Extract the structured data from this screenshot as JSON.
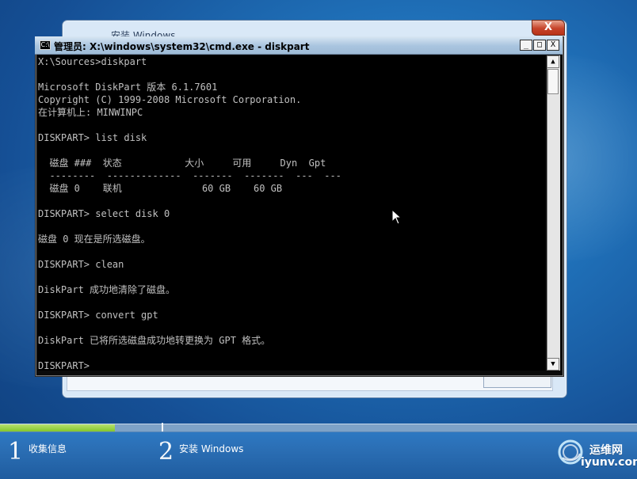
{
  "setup_window": {
    "title": "安装 Windows",
    "close_glyph": "X"
  },
  "cmd_window": {
    "title": "管理员: X:\\windows\\system32\\cmd.exe - diskpart",
    "icon_text": "C:\\",
    "controls": {
      "minimize": "_",
      "maximize": "□",
      "close": "X"
    },
    "scrollbar": {
      "up": "▲",
      "down": "▼"
    },
    "lines": [
      "X:\\Sources>diskpart",
      "",
      "Microsoft DiskPart 版本 6.1.7601",
      "Copyright (C) 1999-2008 Microsoft Corporation.",
      "在计算机上: MINWINPC",
      "",
      "DISKPART> list disk",
      "",
      "  磁盘 ###  状态           大小     可用     Dyn  Gpt",
      "  --------  -------------  -------  -------  ---  ---",
      "  磁盘 0    联机              60 GB    60 GB",
      "",
      "DISKPART> select disk 0",
      "",
      "磁盘 0 现在是所选磁盘。",
      "",
      "DISKPART> clean",
      "",
      "DiskPart 成功地清除了磁盘。",
      "",
      "DISKPART> convert gpt",
      "",
      "DiskPart 已将所选磁盘成功地转更换为 GPT 格式。",
      "",
      "DISKPART>"
    ]
  },
  "progress": {
    "fraction": 0.18
  },
  "steps": [
    {
      "number": "1",
      "label": "收集信息"
    },
    {
      "number": "2",
      "label": "安装 Windows"
    }
  ],
  "watermark": {
    "cn": "运维网",
    "en": "iyunv.com"
  },
  "colors": {
    "console_bg": "#000000",
    "console_fg": "#c0c0c0",
    "progress_green": "#84c72b",
    "setup_close_red": "#c6442b"
  },
  "icons": {
    "cursor": "arrow-cursor-icon",
    "watermark": "watermark-logo-icon"
  }
}
